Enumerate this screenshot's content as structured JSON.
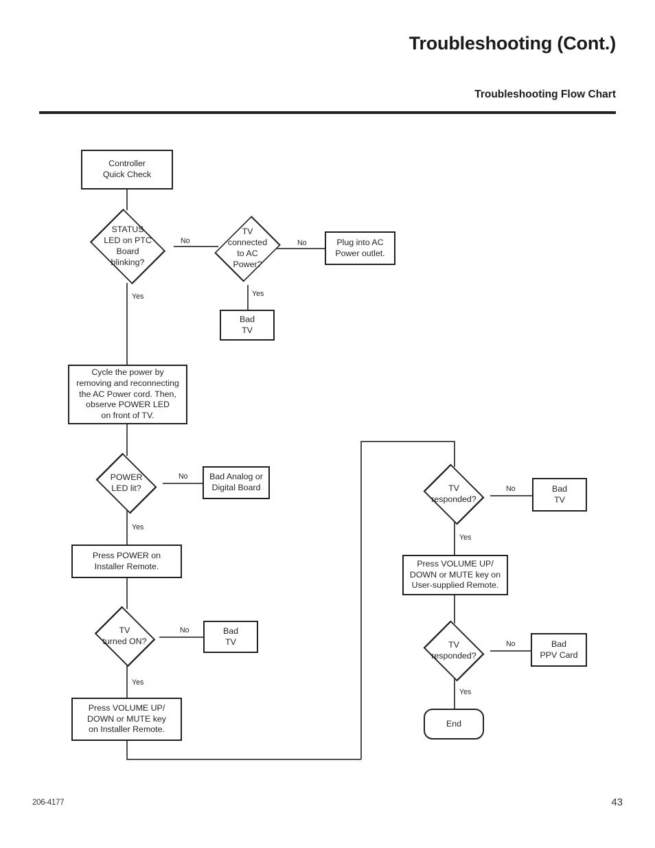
{
  "document": {
    "main_title": "Troubleshooting (Cont.)",
    "sub_title": "Troubleshooting Flow Chart",
    "footer_left": "206-4177",
    "footer_right": "43"
  },
  "chart_data": {
    "type": "diagram",
    "title": "Troubleshooting Flow Chart",
    "nodes": [
      {
        "id": "start",
        "shape": "process",
        "text": "Controller\nQuick Check"
      },
      {
        "id": "status_led",
        "shape": "decision",
        "text": "STATUS\nLED on PTC\nBoard\nblinking?"
      },
      {
        "id": "tv_ac",
        "shape": "decision",
        "text": "TV\nconnected\nto AC\nPower?"
      },
      {
        "id": "plug_ac",
        "shape": "process",
        "text": "Plug into AC\nPower outlet."
      },
      {
        "id": "bad_tv_1",
        "shape": "process",
        "text": "Bad\nTV"
      },
      {
        "id": "cycle_power",
        "shape": "process",
        "text": "Cycle the power by\nremoving and reconnecting\nthe AC Power cord. Then,\nobserve POWER LED\non front of TV."
      },
      {
        "id": "power_led",
        "shape": "decision",
        "text": "POWER\nLED lit?"
      },
      {
        "id": "bad_board",
        "shape": "process",
        "text": "Bad Analog or\nDigital Board"
      },
      {
        "id": "press_power",
        "shape": "process",
        "text": "Press POWER on\nInstaller Remote."
      },
      {
        "id": "tv_on",
        "shape": "decision",
        "text": "TV\nturned ON?"
      },
      {
        "id": "bad_tv_2",
        "shape": "process",
        "text": "Bad\nTV"
      },
      {
        "id": "vol_installer",
        "shape": "process",
        "text": "Press VOLUME UP/\nDOWN or MUTE key\non Installer Remote."
      },
      {
        "id": "responded_1",
        "shape": "decision",
        "text": "TV\nresponded?"
      },
      {
        "id": "bad_tv_3",
        "shape": "process",
        "text": "Bad\nTV"
      },
      {
        "id": "vol_user",
        "shape": "process",
        "text": "Press VOLUME UP/\nDOWN or MUTE key on\nUser-supplied Remote."
      },
      {
        "id": "responded_2",
        "shape": "decision",
        "text": "TV\nresponded?"
      },
      {
        "id": "bad_ppv",
        "shape": "process",
        "text": "Bad\nPPV Card"
      },
      {
        "id": "end",
        "shape": "terminator",
        "text": "End"
      }
    ],
    "edges": [
      {
        "from": "start",
        "to": "status_led",
        "label": ""
      },
      {
        "from": "status_led",
        "to": "tv_ac",
        "label": "No"
      },
      {
        "from": "status_led",
        "to": "cycle_power",
        "label": "Yes"
      },
      {
        "from": "tv_ac",
        "to": "plug_ac",
        "label": "No"
      },
      {
        "from": "tv_ac",
        "to": "bad_tv_1",
        "label": "Yes"
      },
      {
        "from": "cycle_power",
        "to": "power_led",
        "label": ""
      },
      {
        "from": "power_led",
        "to": "bad_board",
        "label": "No"
      },
      {
        "from": "power_led",
        "to": "press_power",
        "label": "Yes"
      },
      {
        "from": "press_power",
        "to": "tv_on",
        "label": ""
      },
      {
        "from": "tv_on",
        "to": "bad_tv_2",
        "label": "No"
      },
      {
        "from": "tv_on",
        "to": "vol_installer",
        "label": "Yes"
      },
      {
        "from": "vol_installer",
        "to": "responded_1",
        "label": ""
      },
      {
        "from": "responded_1",
        "to": "bad_tv_3",
        "label": "No"
      },
      {
        "from": "responded_1",
        "to": "vol_user",
        "label": "Yes"
      },
      {
        "from": "vol_user",
        "to": "responded_2",
        "label": ""
      },
      {
        "from": "responded_2",
        "to": "bad_ppv",
        "label": "No"
      },
      {
        "from": "responded_2",
        "to": "end",
        "label": "Yes"
      }
    ],
    "edge_labels": {
      "status_led_no": "No",
      "status_led_yes": "Yes",
      "tv_ac_no": "No",
      "tv_ac_yes": "Yes",
      "power_led_no": "No",
      "power_led_yes": "Yes",
      "tv_on_no": "No",
      "tv_on_yes": "Yes",
      "responded_1_no": "No",
      "responded_1_yes": "Yes",
      "responded_2_no": "No",
      "responded_2_yes": "Yes"
    }
  },
  "colors": {
    "ink": "#231f20",
    "line": "#4d4d4d",
    "rule": "#231f20",
    "background": "#ffffff"
  }
}
